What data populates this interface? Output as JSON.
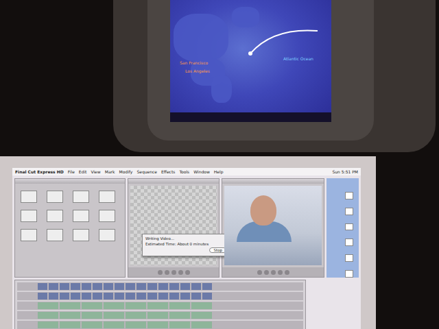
{
  "map": {
    "labels": [
      {
        "text": "Atlantic Ocean",
        "kind": "ocean"
      },
      {
        "text": "San Francisco",
        "kind": "city"
      },
      {
        "text": "Los Angeles",
        "kind": "city"
      }
    ]
  },
  "menubar": {
    "app": "Final Cut Express HD",
    "items": [
      "File",
      "Edit",
      "View",
      "Mark",
      "Modify",
      "Sequence",
      "Effects",
      "Tools",
      "Window",
      "Help"
    ],
    "clock": "Sun 5:51 PM"
  },
  "dialog": {
    "title": "Writing Video...",
    "message": "Estimated Time: About 0 minutes",
    "button": "Stop"
  }
}
